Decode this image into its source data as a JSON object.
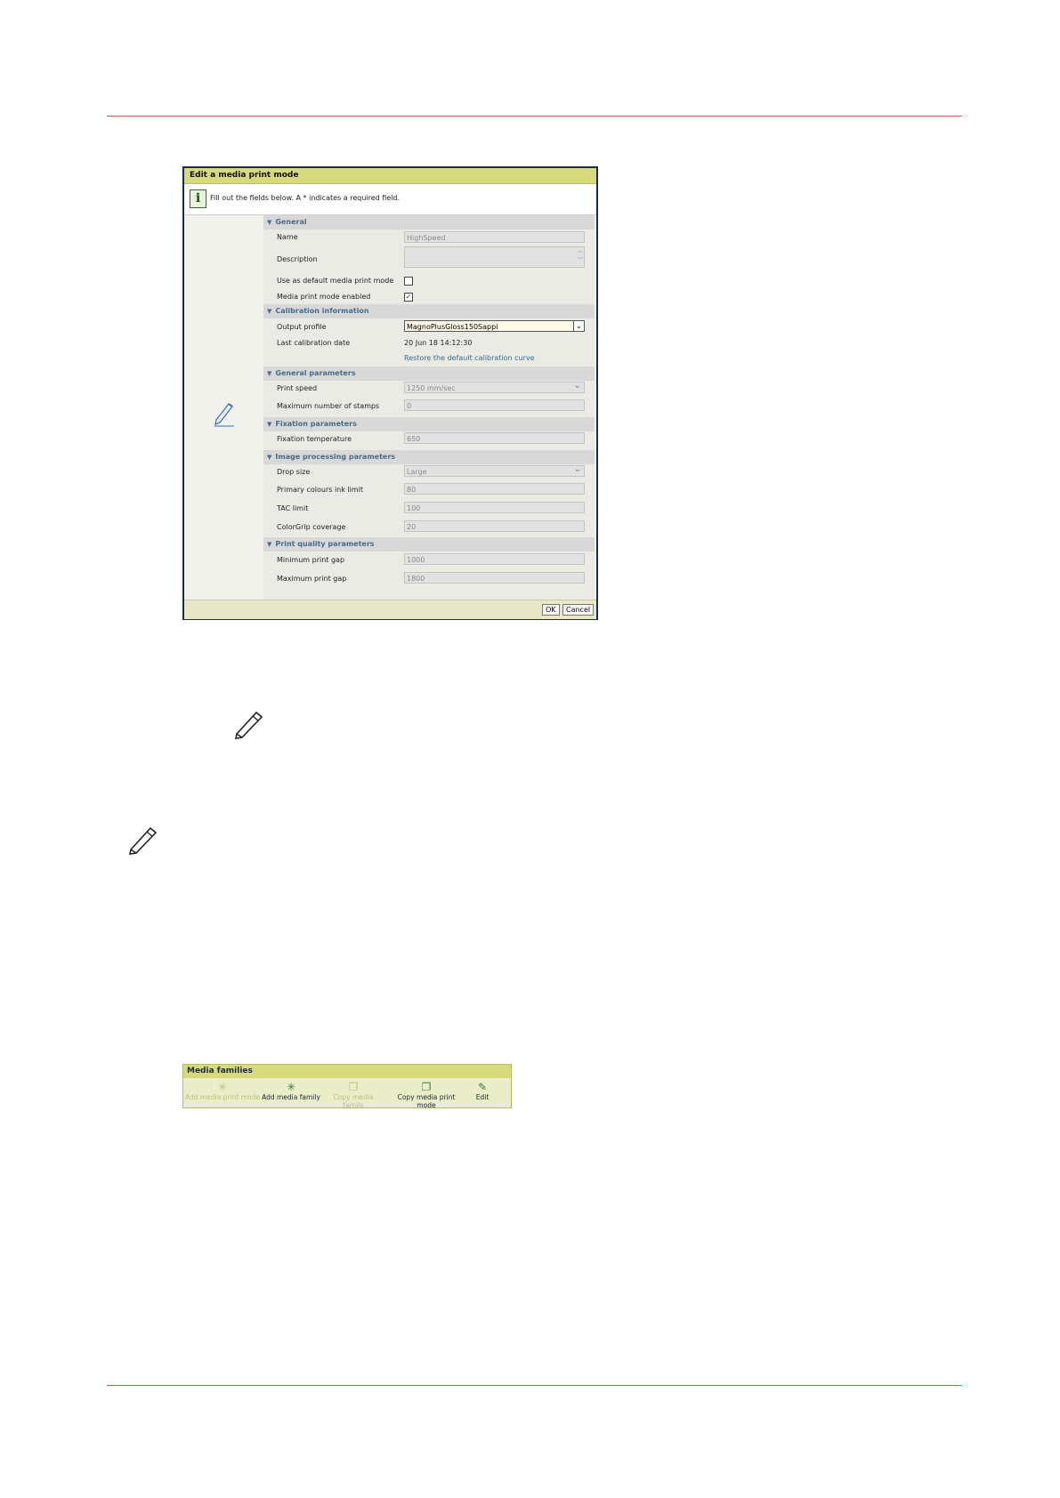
{
  "dialog": {
    "title": "Edit a media print mode",
    "info_text": "Fill out the fields below. A * indicates a required field.",
    "info_icon": "info-icon",
    "sections": {
      "general": "General",
      "calibration": "Calibration information",
      "general_params": "General parameters",
      "fixation": "Fixation parameters",
      "image_processing": "Image processing parameters",
      "print_quality": "Print quality parameters"
    },
    "fields": {
      "name_label": "Name",
      "name_value": "HighSpeed",
      "description_label": "Description",
      "description_value": "",
      "default_label": "Use as default media print mode",
      "default_checked": false,
      "enabled_label": "Media print mode enabled",
      "enabled_checked": true,
      "output_profile_label": "Output profile",
      "output_profile_value": "MagnoPlusGloss150Sappi",
      "last_cal_label": "Last calibration date",
      "last_cal_value": "20 Jun 18 14:12:30",
      "restore_link": "Restore the default calibration curve",
      "print_speed_label": "Print speed",
      "print_speed_value": "1250 mm/sec",
      "max_stamps_label": "Maximum number of stamps",
      "max_stamps_value": "0",
      "fix_temp_label": "Fixation temperature",
      "fix_temp_value": "650",
      "drop_size_label": "Drop size",
      "drop_size_value": "Large",
      "primary_ink_label": "Primary colours ink limit",
      "primary_ink_value": "80",
      "tac_label": "TAC limit",
      "tac_value": "100",
      "colorgrip_label": "ColorGrip coverage",
      "colorgrip_value": "20",
      "min_gap_label": "Minimum print gap",
      "min_gap_value": "1000",
      "max_gap_label": "Maximum print gap",
      "max_gap_value": "1800"
    },
    "ok_label": "OK",
    "cancel_label": "Cancel"
  },
  "toolbar": {
    "title": "Media families",
    "items": [
      {
        "label": "Add media print mode",
        "enabled": false,
        "icon": "add-sparkle-icon"
      },
      {
        "label": "Add media family",
        "enabled": true,
        "icon": "add-sparkle-icon"
      },
      {
        "label": "Copy media family",
        "enabled": false,
        "icon": "copy-icon"
      },
      {
        "label": "Copy media print mode",
        "enabled": true,
        "icon": "copy-icon"
      },
      {
        "label": "Edit",
        "enabled": true,
        "icon": "pencil-icon"
      }
    ]
  }
}
